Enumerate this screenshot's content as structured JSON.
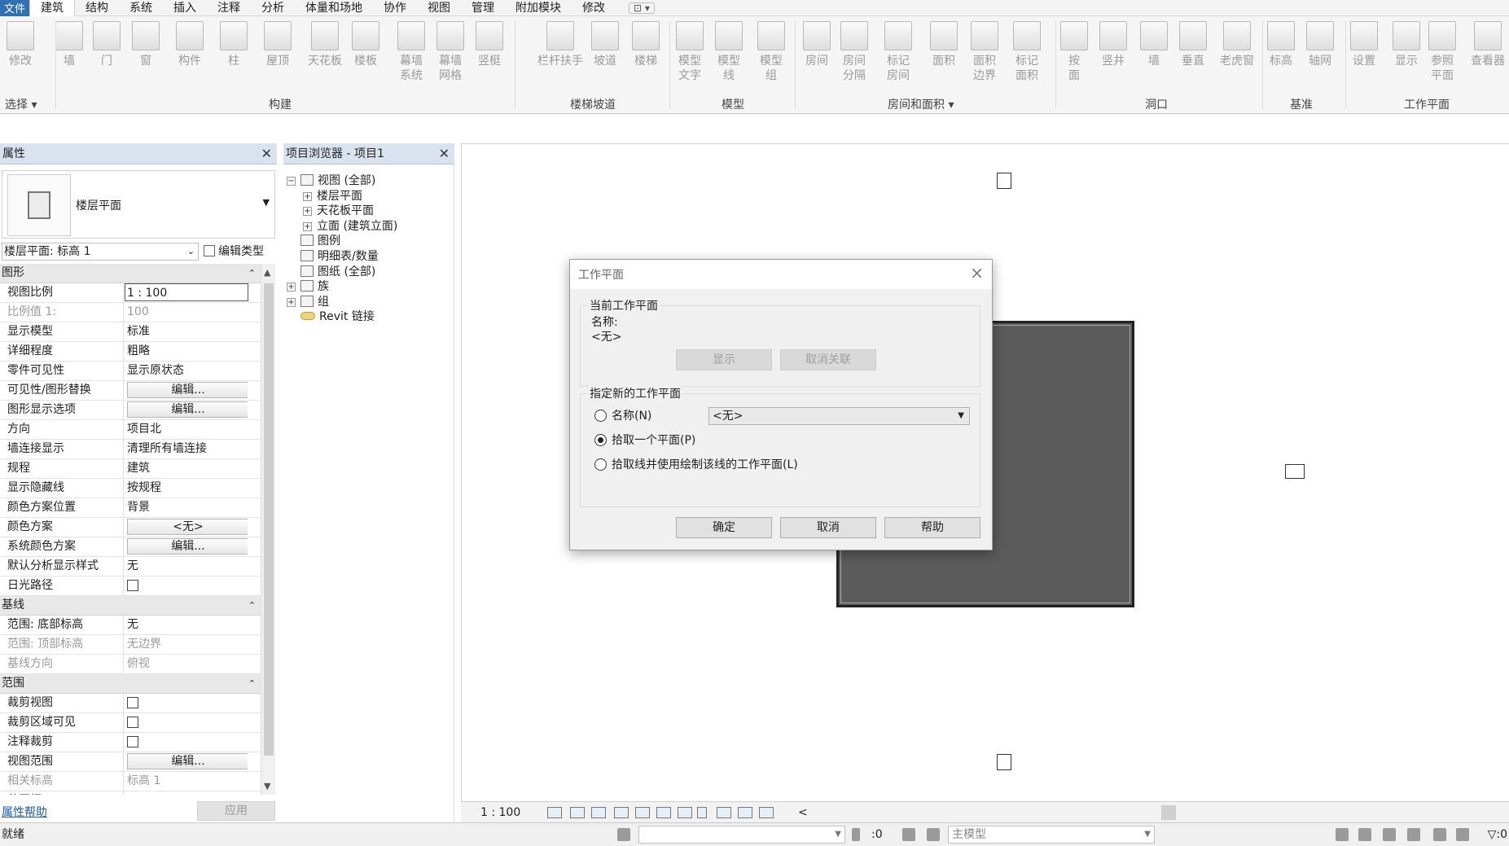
{
  "menu": {
    "file": "文件",
    "tabs": [
      "建筑",
      "结构",
      "系统",
      "插入",
      "注释",
      "分析",
      "体量和场地",
      "协作",
      "视图",
      "管理",
      "附加模块",
      "修改"
    ],
    "active_tab": "建筑"
  },
  "ribbon": {
    "tools": [
      {
        "label": "修改",
        "icon": "modify-arrow-icon"
      },
      {
        "label": "墙",
        "icon": "wall-icon"
      },
      {
        "label": "门",
        "icon": "door-icon"
      },
      {
        "label": "窗",
        "icon": "window-icon"
      },
      {
        "label": "构件",
        "icon": "component-icon"
      },
      {
        "label": "柱",
        "icon": "column-icon"
      },
      {
        "label": "屋顶",
        "icon": "roof-icon"
      },
      {
        "label": "天花板",
        "icon": "ceiling-icon"
      },
      {
        "label": "楼板",
        "icon": "floor-icon"
      },
      {
        "label": "幕墙\n系统",
        "icon": "curtain-system-icon"
      },
      {
        "label": "幕墙\n网格",
        "icon": "curtain-grid-icon"
      },
      {
        "label": "竖梃",
        "icon": "mullion-icon"
      },
      {
        "label": "栏杆扶手",
        "icon": "railing-icon"
      },
      {
        "label": "坡道",
        "icon": "ramp-icon"
      },
      {
        "label": "楼梯",
        "icon": "stair-icon"
      },
      {
        "label": "模型\n文字",
        "icon": "model-text-icon"
      },
      {
        "label": "模型\n线",
        "icon": "model-line-icon"
      },
      {
        "label": "模型\n组",
        "icon": "model-group-icon"
      },
      {
        "label": "房间",
        "icon": "room-icon"
      },
      {
        "label": "房间\n分隔",
        "icon": "room-separator-icon"
      },
      {
        "label": "标记\n房间",
        "icon": "tag-room-icon"
      },
      {
        "label": "面积",
        "icon": "area-icon"
      },
      {
        "label": "面积\n边界",
        "icon": "area-boundary-icon"
      },
      {
        "label": "标记\n面积",
        "icon": "tag-area-icon"
      },
      {
        "label": "按\n面",
        "icon": "by-face-icon"
      },
      {
        "label": "竖井",
        "icon": "shaft-icon"
      },
      {
        "label": "墙",
        "icon": "wall-opening-icon"
      },
      {
        "label": "垂直",
        "icon": "vertical-opening-icon"
      },
      {
        "label": "老虎窗",
        "icon": "dormer-icon"
      },
      {
        "label": "标高",
        "icon": "level-icon"
      },
      {
        "label": "轴网",
        "icon": "grid-icon"
      },
      {
        "label": "设置",
        "icon": "set-workplane-icon"
      },
      {
        "label": "显示",
        "icon": "show-workplane-icon"
      },
      {
        "label": "参照\n平面",
        "icon": "ref-plane-icon"
      },
      {
        "label": "查看器",
        "icon": "viewer-icon"
      }
    ],
    "panels": [
      "选择 ▾",
      "构建",
      "楼梯坡道",
      "模型",
      "房间和面积 ▾",
      "洞口",
      "基准",
      "工作平面"
    ]
  },
  "properties": {
    "title": "属性",
    "type_name": "楼层平面",
    "instance_selector": "楼层平面: 标高 1",
    "edit_type": "编辑类型",
    "rows": [
      {
        "group": "图形"
      },
      {
        "k": "视图比例",
        "v": "1 : 100",
        "kind": "box"
      },
      {
        "k": "比例值 1:",
        "v": "100",
        "kind": "grey"
      },
      {
        "k": "显示模型",
        "v": "标准"
      },
      {
        "k": "详细程度",
        "v": "粗略"
      },
      {
        "k": "零件可见性",
        "v": "显示原状态"
      },
      {
        "k": "可见性/图形替换",
        "v": "编辑...",
        "kind": "btn"
      },
      {
        "k": "图形显示选项",
        "v": "编辑...",
        "kind": "btn"
      },
      {
        "k": "方向",
        "v": "项目北"
      },
      {
        "k": "墙连接显示",
        "v": "清理所有墙连接"
      },
      {
        "k": "规程",
        "v": "建筑"
      },
      {
        "k": "显示隐藏线",
        "v": "按规程"
      },
      {
        "k": "颜色方案位置",
        "v": "背景"
      },
      {
        "k": "颜色方案",
        "v": "<无>",
        "kind": "btn"
      },
      {
        "k": "系统颜色方案",
        "v": "编辑...",
        "kind": "btn"
      },
      {
        "k": "默认分析显示样式",
        "v": "无"
      },
      {
        "k": "日光路径",
        "v": "",
        "kind": "cb"
      },
      {
        "group": "基线"
      },
      {
        "k": "范围: 底部标高",
        "v": "无"
      },
      {
        "k": "范围: 顶部标高",
        "v": "无边界",
        "kind": "grey"
      },
      {
        "k": "基线方向",
        "v": "俯视",
        "kind": "grey"
      },
      {
        "group": "范围"
      },
      {
        "k": "裁剪视图",
        "v": "",
        "kind": "cb"
      },
      {
        "k": "裁剪区域可见",
        "v": "",
        "kind": "cb"
      },
      {
        "k": "注释裁剪",
        "v": "",
        "kind": "cb"
      },
      {
        "k": "视图范围",
        "v": "编辑...",
        "kind": "btn"
      },
      {
        "k": "相关标高",
        "v": "标高 1",
        "kind": "grey"
      },
      {
        "k": "范围框",
        "v": "无"
      }
    ],
    "help_link": "属性帮助",
    "apply": "应用"
  },
  "browser": {
    "title": "项目浏览器 - 项目1",
    "nodes": [
      {
        "label": "视图 (全部)",
        "exp": "−",
        "indent": 0
      },
      {
        "label": "楼层平面",
        "exp": "+",
        "indent": 1
      },
      {
        "label": "天花板平面",
        "exp": "+",
        "indent": 1
      },
      {
        "label": "立面 (建筑立面)",
        "exp": "+",
        "indent": 1
      },
      {
        "label": "图例",
        "exp": "",
        "indent": 0
      },
      {
        "label": "明细表/数量",
        "exp": "",
        "indent": 0
      },
      {
        "label": "图纸 (全部)",
        "exp": "",
        "indent": 0
      },
      {
        "label": "族",
        "exp": "+",
        "indent": 0
      },
      {
        "label": "组",
        "exp": "+",
        "indent": 0
      },
      {
        "label": "Revit 链接",
        "exp": "",
        "indent": 0,
        "icon": "link"
      }
    ]
  },
  "dialog": {
    "title": "工作平面",
    "current_group": "当前工作平面",
    "name_label": "名称:",
    "name_value": "<无>",
    "show_btn": "显示",
    "dissociate_btn": "取消关联",
    "specify_group": "指定新的工作平面",
    "opt_name": "名称(N)",
    "name_select": "<无>",
    "opt_pick_plane": "拾取一个平面(P)",
    "opt_pick_line": "拾取线并使用绘制该线的工作平面(L)",
    "selected_option": "pick_plane",
    "ok": "确定",
    "cancel": "取消",
    "help": "帮助"
  },
  "viewbar": {
    "scale": "1 : 100",
    "scroll_left": "<"
  },
  "status": {
    "text": "就绪",
    "zero": ":0",
    "model": "主模型",
    "filter": ":0"
  }
}
